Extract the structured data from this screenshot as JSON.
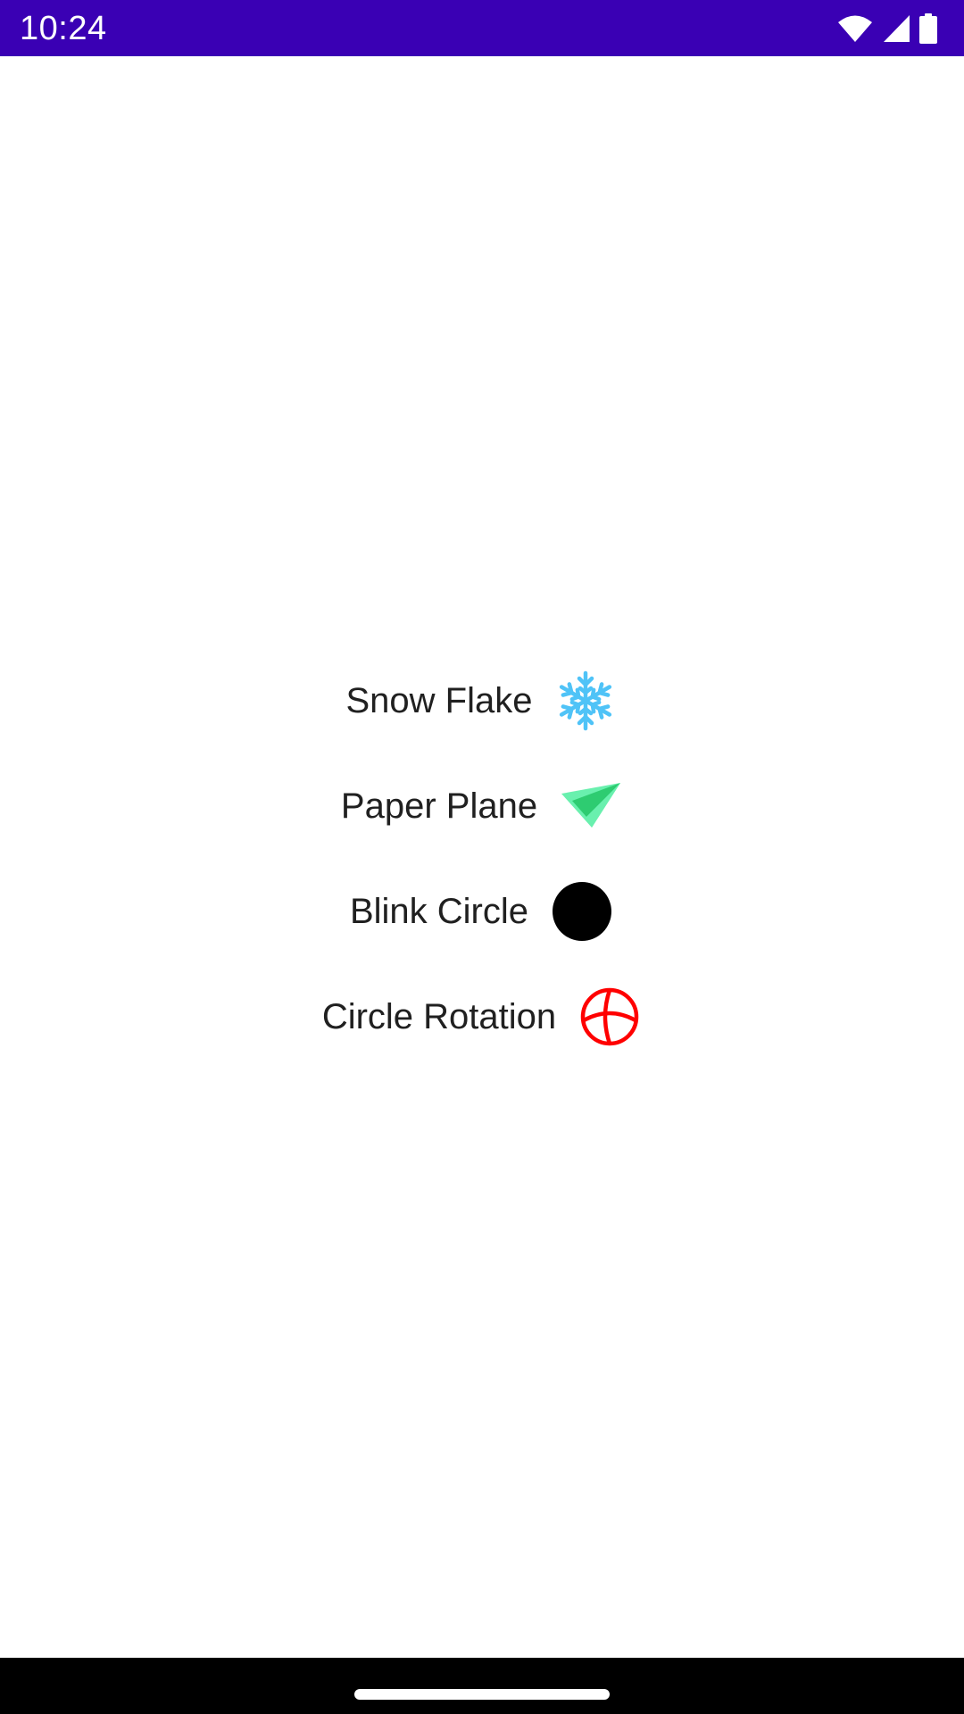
{
  "status_bar": {
    "time": "10:24",
    "background_color": "#3a00b4",
    "icons": [
      "wifi-icon",
      "cellular-signal-icon",
      "battery-icon"
    ]
  },
  "rows": [
    {
      "label": "Snow Flake",
      "icon": "snowflake-icon",
      "icon_color": "#4fc3f7"
    },
    {
      "label": "Paper Plane",
      "icon": "paper-plane-icon",
      "icon_color": "#69f0ae"
    },
    {
      "label": "Blink Circle",
      "icon": "filled-circle-icon",
      "icon_color": "#000000"
    },
    {
      "label": "Circle Rotation",
      "icon": "globe-circle-icon",
      "icon_color": "#ff0000"
    }
  ],
  "nav_bar": {
    "background_color": "#000000",
    "home_indicator": "home-indicator"
  }
}
